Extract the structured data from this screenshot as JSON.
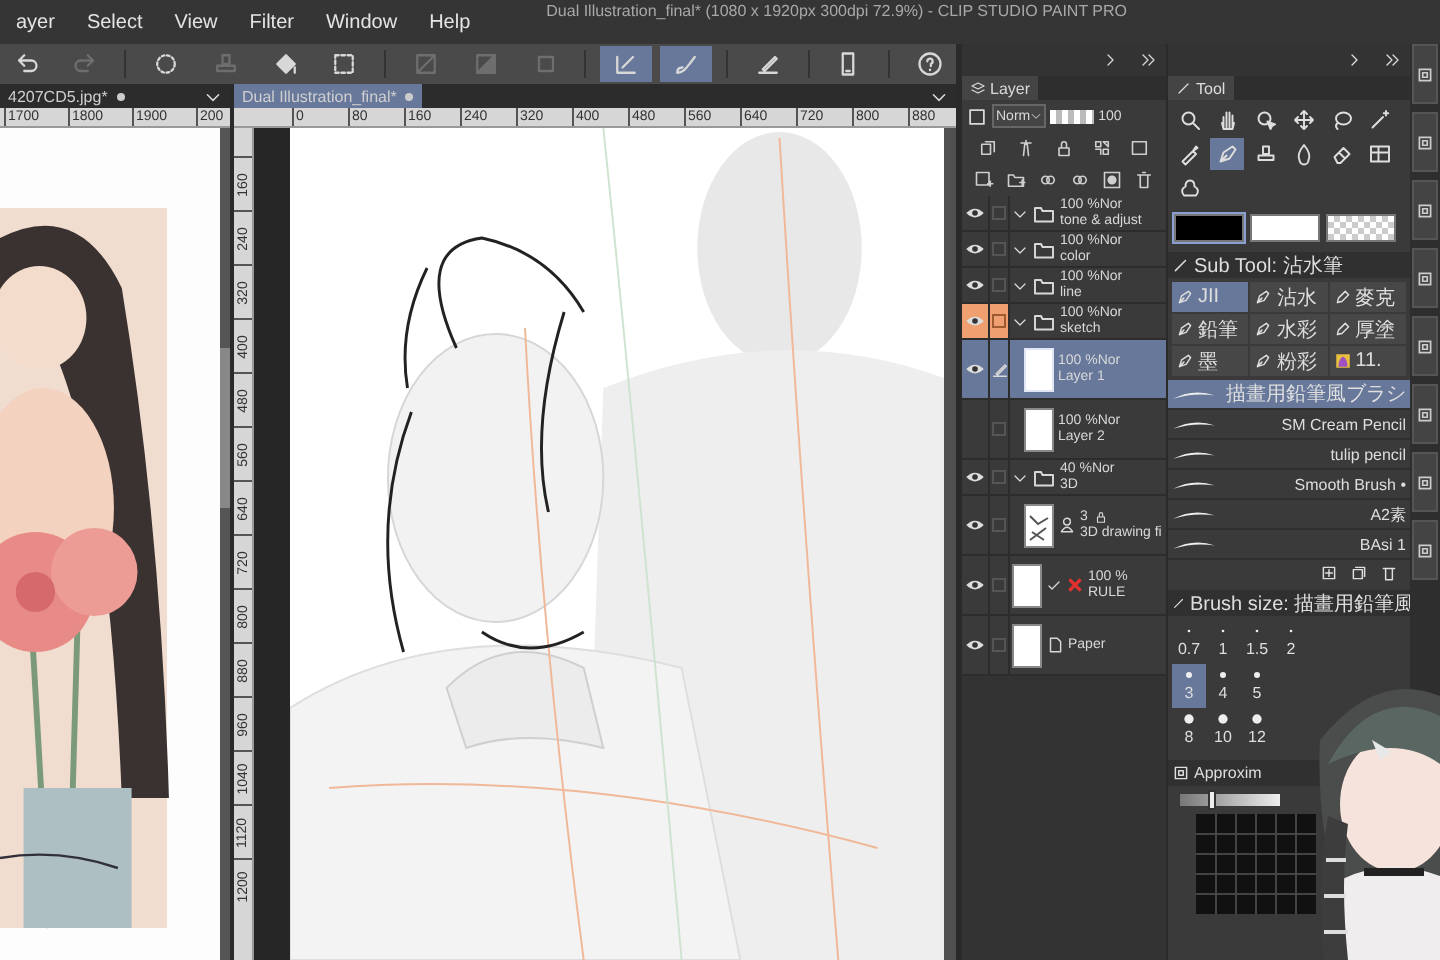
{
  "window": {
    "title": "Dual Illustration_final* (1080 x 1920px 300dpi 72.9%) - CLIP STUDIO PAINT PRO"
  },
  "menu": [
    "ayer",
    "Select",
    "View",
    "Filter",
    "Window",
    "Help"
  ],
  "toolbar": [
    {
      "kind": "undo",
      "selected": false,
      "disabled": false,
      "separator_before": false
    },
    {
      "kind": "redo",
      "selected": false,
      "disabled": true,
      "separator_before": false
    },
    {
      "kind": "loader",
      "selected": false,
      "disabled": false,
      "separator_before": true
    },
    {
      "kind": "stamp",
      "selected": false,
      "disabled": true,
      "separator_before": false
    },
    {
      "kind": "fill",
      "selected": false,
      "disabled": false,
      "separator_before": false
    },
    {
      "kind": "crop",
      "selected": false,
      "disabled": false,
      "separator_before": false
    },
    {
      "kind": "clear",
      "selected": false,
      "disabled": true,
      "separator_before": true
    },
    {
      "kind": "shade",
      "selected": false,
      "disabled": true,
      "separator_before": false
    },
    {
      "kind": "frame",
      "selected": false,
      "disabled": true,
      "separator_before": false
    },
    {
      "kind": "ruler",
      "selected": true,
      "disabled": false,
      "separator_before": true
    },
    {
      "kind": "brush",
      "selected": true,
      "disabled": false,
      "separator_before": false
    },
    {
      "kind": "line",
      "selected": false,
      "disabled": false,
      "separator_before": true
    },
    {
      "kind": "device",
      "selected": false,
      "disabled": false,
      "separator_before": true
    },
    {
      "kind": "help",
      "selected": false,
      "disabled": false,
      "separator_before": true
    }
  ],
  "document_tabs": [
    {
      "label": "4207CD5.jpg*",
      "selected": false
    },
    {
      "label": "Dual Illustration_final*",
      "selected": true
    }
  ],
  "reference_ruler": [
    "1700",
    "1800",
    "1900",
    "200"
  ],
  "canvas_ruler": {
    "horizontal": [
      "0",
      "80",
      "160",
      "240",
      "320",
      "400",
      "480",
      "560",
      "640",
      "720",
      "800",
      "880"
    ],
    "vertical": [
      "160",
      "240",
      "320",
      "400",
      "480",
      "560",
      "640",
      "720",
      "800",
      "880",
      "960",
      "1040",
      "1120",
      "1200"
    ]
  },
  "layer_panel": {
    "tab": "Layer",
    "blend_mode": "Norm",
    "opacity": "100",
    "opacity_slider": {
      "level": 1
    },
    "layers": [
      {
        "kind": "folder",
        "opacity": "100 %Nor",
        "name": "tone & adjust",
        "visible": true,
        "highlighted": false,
        "selected": false,
        "expanded": true
      },
      {
        "kind": "folder",
        "opacity": "100 %Nor",
        "name": "color",
        "visible": true,
        "highlighted": false,
        "selected": false,
        "expanded": true
      },
      {
        "kind": "folder",
        "opacity": "100 %Nor",
        "name": "line",
        "visible": true,
        "highlighted": false,
        "selected": false,
        "expanded": true
      },
      {
        "kind": "folder",
        "opacity": "100 %Nor",
        "name": "sketch",
        "visible": true,
        "highlighted": true,
        "selected": false,
        "expanded": true,
        "children": [
          {
            "kind": "layer",
            "opacity": "100 %Nor",
            "name": "Layer 1",
            "visible": true,
            "highlighted": false,
            "selected": true
          },
          {
            "kind": "layer",
            "opacity": "100 %Nor",
            "name": "Layer 2",
            "visible": false,
            "highlighted": false,
            "selected": false
          }
        ]
      },
      {
        "kind": "folder",
        "opacity": "40 %Nor",
        "name": "3D",
        "visible": true,
        "highlighted": false,
        "selected": false,
        "expanded": true,
        "children": [
          {
            "kind": "model",
            "count": "3",
            "name": "3D drawing fi",
            "visible": true,
            "highlighted": false,
            "selected": false
          }
        ]
      },
      {
        "kind": "ruler",
        "opacity": "100 %",
        "name": "RULE",
        "visible": true,
        "highlighted": false,
        "selected": false
      },
      {
        "kind": "paper",
        "name": "Paper",
        "visible": true,
        "highlighted": false,
        "selected": false
      }
    ]
  },
  "tool_panel": {
    "tab": "Tool",
    "tools": [
      {
        "kind": "zoom",
        "selected": false
      },
      {
        "kind": "hand",
        "selected": false
      },
      {
        "kind": "cursor",
        "selected": false
      },
      {
        "kind": "move",
        "selected": false
      },
      {
        "kind": "lasso",
        "selected": false
      },
      {
        "kind": "wand",
        "selected": false
      },
      {
        "kind": "eyedropper",
        "selected": false
      },
      {
        "kind": "pen",
        "selected": true
      },
      {
        "kind": "stamp",
        "selected": false
      },
      {
        "kind": "drop",
        "selected": false
      },
      {
        "kind": "eraser",
        "selected": false
      },
      {
        "kind": "grid",
        "selected": false
      },
      {
        "kind": "splash",
        "selected": false
      }
    ],
    "colors": [
      {
        "kind": "main",
        "color": "#000000",
        "selected": true
      },
      {
        "kind": "sub",
        "color": "#ffffff",
        "selected": false
      },
      {
        "kind": "transparent",
        "selected": false
      }
    ],
    "sub_tool": {
      "title": "Sub Tool: 沾水筆",
      "groups": [
        {
          "kind": "pen",
          "label": "JII",
          "selected": true
        },
        {
          "kind": "pen",
          "label": "沾水",
          "selected": false
        },
        {
          "kind": "marker",
          "label": "麥克",
          "selected": false
        },
        {
          "kind": "pen",
          "label": "鉛筆",
          "selected": false
        },
        {
          "kind": "pen",
          "label": "水彩",
          "selected": false
        },
        {
          "kind": "marker",
          "label": "厚塗",
          "selected": false
        },
        {
          "kind": "pen",
          "label": "墨",
          "selected": false
        },
        {
          "kind": "pen",
          "label": "粉彩",
          "selected": false
        },
        {
          "label": "11.",
          "selected": false
        }
      ],
      "brushes": [
        {
          "name": "描畫用鉛筆風ブラシ",
          "selected": true
        },
        {
          "name": "SM Cream Pencil",
          "selected": false
        },
        {
          "name": "tulip pencil",
          "selected": false
        },
        {
          "name": "Smooth Brush •",
          "selected": false
        },
        {
          "name": "A2素",
          "selected": false
        },
        {
          "name": "BAsi 1",
          "selected": false
        }
      ]
    },
    "brush_size": {
      "title": "Brush size: 描畫用鉛筆風",
      "rows": [
        [
          {
            "label": "0.7",
            "selected": false
          },
          {
            "label": "1",
            "selected": false
          },
          {
            "label": "1.5",
            "selected": false
          },
          {
            "label": "2",
            "selected": false
          }
        ],
        [
          {
            "label": "3",
            "selected": true
          },
          {
            "label": "4",
            "selected": false
          },
          {
            "label": "5",
            "selected": false
          }
        ],
        [
          {
            "label": "8",
            "selected": false
          },
          {
            "label": "10",
            "selected": false
          },
          {
            "label": "12",
            "selected": false
          }
        ]
      ]
    },
    "approximate_color": {
      "title": "Approxim",
      "slider": {
        "level": 0.32
      }
    }
  }
}
